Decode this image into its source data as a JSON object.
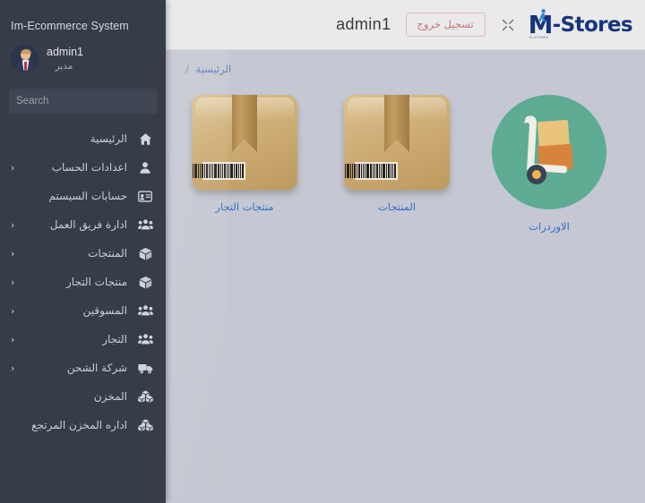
{
  "app": {
    "brand_title": "Im-Ecommerce System",
    "sidebar_bg": "#363d49",
    "content_bg": "#c5c7d2",
    "header_bg": "#eaeaea",
    "accent_blue": "#2f6fc4",
    "logo_blue": "#16357c"
  },
  "profile": {
    "name": "admin1",
    "role": "مدير",
    "avatar_icon": "user-avatar"
  },
  "search": {
    "placeholder": "Search",
    "value": "",
    "button_icon": "search-icon"
  },
  "sidebar": {
    "items": [
      {
        "label": "الرئيسية",
        "icon": "home-icon",
        "chevron": false
      },
      {
        "label": "اعدادات الحساب",
        "icon": "user-icon",
        "chevron": true
      },
      {
        "label": "حسابات السيستم",
        "icon": "id-card-icon",
        "chevron": false
      },
      {
        "label": "ادارة فريق العمل",
        "icon": "users-icon",
        "chevron": true
      },
      {
        "label": "المنتجات",
        "icon": "box-icon",
        "chevron": true
      },
      {
        "label": "منتجات التجار",
        "icon": "box-icon",
        "chevron": true
      },
      {
        "label": "المسوقين",
        "icon": "users-icon",
        "chevron": true
      },
      {
        "label": "التجار",
        "icon": "users-icon",
        "chevron": true
      },
      {
        "label": "شركة الشحن",
        "icon": "truck-icon",
        "chevron": true
      },
      {
        "label": "المخزن",
        "icon": "boxes-icon",
        "chevron": false
      },
      {
        "label": "اداره المخزن المرتجع",
        "icon": "boxes-icon",
        "chevron": false
      }
    ],
    "chevron_glyph": "‹"
  },
  "header": {
    "admin_name": "admin1",
    "logout_label": "تسجيل خروج",
    "fullscreen_icon": "fullscreen-expand-icon",
    "logo_letter": "M",
    "logo_text": "-Stores",
    "logo_subtext": "M-STORES"
  },
  "breadcrumb": {
    "separator": "/",
    "current": "الرئيسية"
  },
  "cards": [
    {
      "label": "الاوردرات",
      "icon": "hand-truck-icon",
      "style": "circle-green"
    },
    {
      "label": "المنتجات",
      "icon": "package-box-icon",
      "style": "box"
    },
    {
      "label": "منتجات التجار",
      "icon": "package-box-icon",
      "style": "box"
    }
  ]
}
